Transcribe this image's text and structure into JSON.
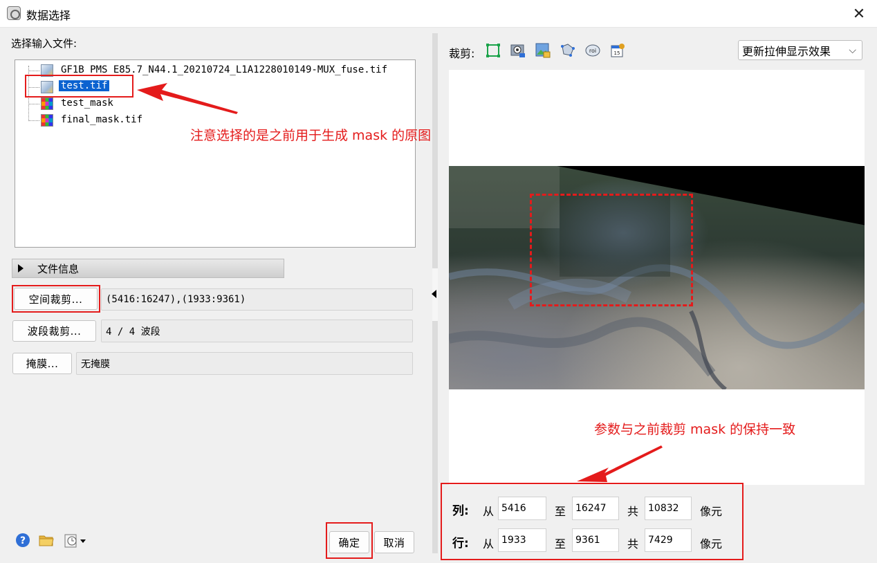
{
  "window": {
    "title": "数据选择",
    "close_glyph": "✕"
  },
  "left": {
    "input_files_label": "选择输入文件:",
    "files": [
      {
        "name": "GF1B_PMS_E85.7_N44.1_20210724_L1A1228010149-MUX_fuse.tif",
        "icon": "raster-file-icon",
        "selected": false
      },
      {
        "name": "test.tif",
        "icon": "raster-file-icon",
        "selected": true
      },
      {
        "name": "test_mask",
        "icon": "mask-grid-icon",
        "selected": false
      },
      {
        "name": "final_mask.tif",
        "icon": "mask-grid-icon",
        "selected": false
      }
    ],
    "file_info_label": "文件信息",
    "spatial_subset_button": "空间裁剪...",
    "spatial_subset_value": "(5416:16247),(1933:9361)",
    "band_subset_button": "波段裁剪...",
    "band_subset_value": "4 / 4 波段",
    "mask_button": "掩膜...",
    "mask_value": "无掩膜",
    "ok_button": "确定",
    "cancel_button": "取消"
  },
  "annotations": {
    "file_note": "注意选择的是之前用于生成 mask 的原图",
    "param_note": "参数与之前裁剪 mask 的保持一致",
    "color": "#e41b1b"
  },
  "right": {
    "subset_label": "裁剪:",
    "stretch_dropdown": "更新拉伸显示效果",
    "columns": {
      "label": "列:",
      "from_label": "从",
      "from": "5416",
      "to_label": "至",
      "to": "16247",
      "total_label": "共",
      "total": "10832",
      "unit": "像元"
    },
    "rows": {
      "label": "行:",
      "from_label": "从",
      "from": "1933",
      "to_label": "至",
      "to": "9361",
      "total_label": "共",
      "total": "7429",
      "unit": "像元"
    }
  },
  "colors": {
    "selection": "#0b62d0",
    "accent_red": "#e41b1b"
  }
}
